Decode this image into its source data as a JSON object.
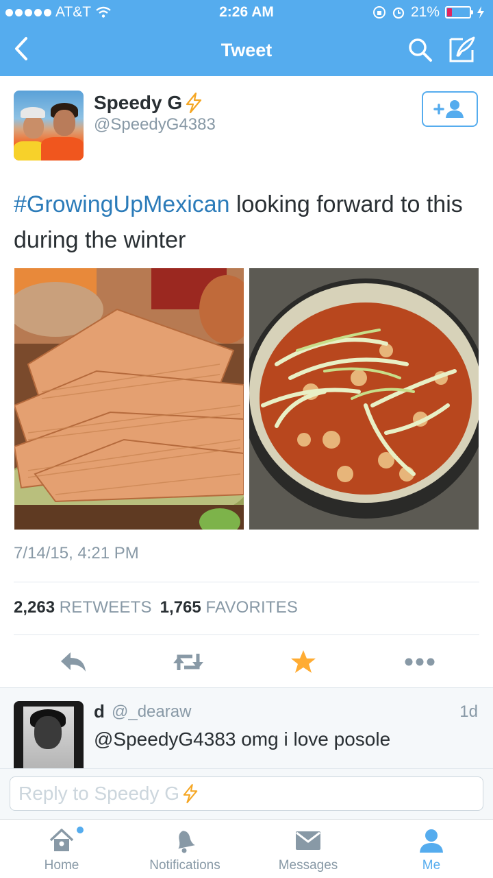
{
  "status_bar": {
    "carrier": "AT&T",
    "time": "2:26 AM",
    "battery": "21%",
    "battery_level": 0.21
  },
  "nav": {
    "title": "Tweet",
    "back_icon": "chevron-left-icon",
    "search_icon": "search-icon",
    "compose_icon": "compose-icon"
  },
  "tweet": {
    "author_name": "Speedy G",
    "author_handle": "@SpeedyG4383",
    "hashtag": "#GrowingUpMexican",
    "text": " looking forward to this during the winter",
    "timestamp": "7/14/15, 4:21 PM",
    "retweets_count": "2,263",
    "retweets_label": "RETWEETS",
    "favorites_count": "1,765",
    "favorites_label": "FAVORITES",
    "favorited": true
  },
  "reply": {
    "name": "d",
    "handle": "@_dearaw",
    "time": "1d",
    "text": "@SpeedyG4383 omg i love posole"
  },
  "composer": {
    "placeholder": "Reply to Speedy G"
  },
  "tabs": [
    {
      "label": "Home",
      "icon": "home-icon",
      "active": false
    },
    {
      "label": "Notifications",
      "icon": "bell-icon",
      "active": false
    },
    {
      "label": "Messages",
      "icon": "envelope-icon",
      "active": false
    },
    {
      "label": "Me",
      "icon": "person-icon",
      "active": true
    }
  ],
  "colors": {
    "brand": "#55acee",
    "hashtag": "#2b7bb9",
    "favorite": "#ffac33",
    "muted": "#8899a6"
  }
}
